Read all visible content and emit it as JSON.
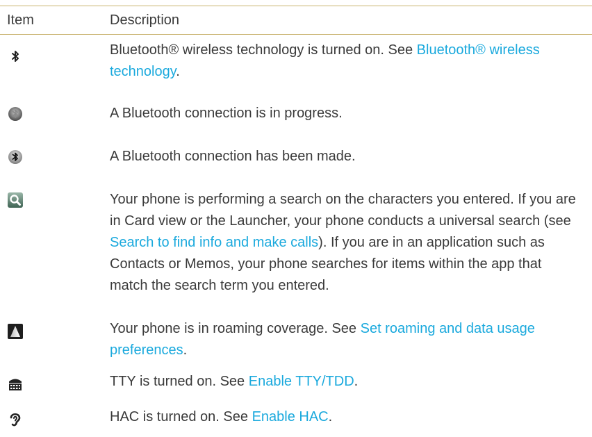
{
  "table": {
    "header": {
      "item": "Item",
      "description": "Description"
    },
    "rows": [
      {
        "icon": "bluetooth-on-icon",
        "text": "Bluetooth® wireless technology is turned on. See ",
        "link": "Bluetooth® wireless technology",
        "after": "."
      },
      {
        "icon": "bluetooth-connecting-icon",
        "text": "A Bluetooth connection is in progress."
      },
      {
        "icon": "bluetooth-connected-icon",
        "text": "A Bluetooth connection has been made."
      },
      {
        "icon": "search-icon",
        "text": "Your phone is performing a search on the characters you entered. If you are in Card view or the Launcher, your phone conducts a universal search (see ",
        "link": "Search to find info and make calls",
        "after": "). If you are in an application such as Contacts or Memos, your phone searches for items within the app that match the search term you entered."
      },
      {
        "icon": "roaming-icon",
        "text": "Your phone is in roaming coverage. See ",
        "link": "Set roaming and data usage preferences",
        "after": "."
      },
      {
        "icon": "tty-icon",
        "text": "TTY is turned on. See ",
        "link": "Enable TTY/TDD",
        "after": "."
      },
      {
        "icon": "hac-icon",
        "text": "HAC is turned on. See ",
        "link": "Enable HAC",
        "after": "."
      }
    ]
  },
  "colors": {
    "link": "#1aa9dd",
    "text": "#3a3a3a",
    "rule": "#c7b16a"
  }
}
